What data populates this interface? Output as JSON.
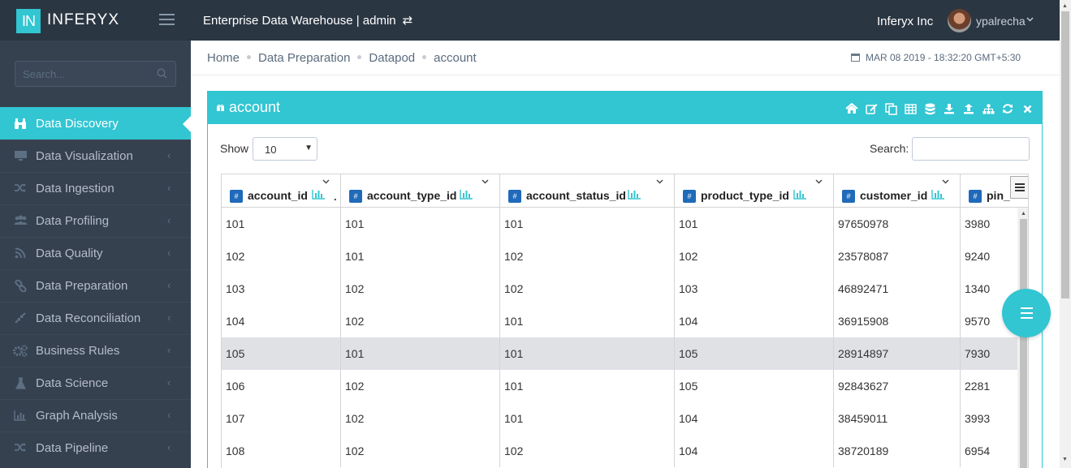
{
  "brand": {
    "logo_mark": "IN",
    "name": "INFERYX"
  },
  "header": {
    "app_title": "Enterprise Data Warehouse | admin",
    "switch_icon": "⇄",
    "org_name": "Inferyx Inc",
    "user_name": "ypalrecha"
  },
  "sidebar": {
    "search_placeholder": "Search...",
    "items": [
      {
        "label": "Data Discovery",
        "icon": "binoculars-icon",
        "active": true
      },
      {
        "label": "Data Visualization",
        "icon": "monitor-icon"
      },
      {
        "label": "Data Ingestion",
        "icon": "shuffle-icon"
      },
      {
        "label": "Data Profiling",
        "icon": "users-icon"
      },
      {
        "label": "Data Quality",
        "icon": "rss-icon"
      },
      {
        "label": "Data Preparation",
        "icon": "link-icon"
      },
      {
        "label": "Data Reconciliation",
        "icon": "compress-icon"
      },
      {
        "label": "Business Rules",
        "icon": "gears-icon"
      },
      {
        "label": "Data Science",
        "icon": "flask-icon"
      },
      {
        "label": "Graph Analysis",
        "icon": "bar-chart-icon"
      },
      {
        "label": "Data Pipeline",
        "icon": "shuffle-icon"
      }
    ]
  },
  "breadcrumb": [
    "Home",
    "Data Preparation",
    "Datapod",
    "account"
  ],
  "datetime": "MAR 08 2019 - 18:32:20 GMT+5:30",
  "portlet": {
    "title": "account",
    "tools": [
      "home-icon",
      "edit-icon",
      "copy-icon",
      "table-icon",
      "database-icon",
      "download-icon",
      "upload-icon",
      "sitemap-icon",
      "refresh-icon",
      "close-icon"
    ]
  },
  "controls": {
    "show_label": "Show",
    "page_size": "10",
    "search_label": "Search:"
  },
  "table": {
    "type_badge": "#",
    "columns": [
      "account_id",
      "account_type_id",
      "account_status_id",
      "product_type_id",
      "customer_id",
      "pin_"
    ],
    "rows": [
      [
        "101",
        "101",
        "101",
        "101",
        "97650978",
        "3980"
      ],
      [
        "102",
        "101",
        "102",
        "102",
        "23578087",
        "9240"
      ],
      [
        "103",
        "102",
        "102",
        "103",
        "46892471",
        "1340"
      ],
      [
        "104",
        "102",
        "101",
        "104",
        "36915908",
        "9570"
      ],
      [
        "105",
        "101",
        "101",
        "105",
        "28914897",
        "7930"
      ],
      [
        "106",
        "102",
        "101",
        "105",
        "92843627",
        "2281"
      ],
      [
        "107",
        "102",
        "101",
        "104",
        "38459011",
        "3993"
      ],
      [
        "108",
        "102",
        "102",
        "104",
        "38720189",
        "6954"
      ]
    ],
    "highlighted_row": 4
  },
  "colors": {
    "accent": "#32c5d2",
    "topbar": "#2b3643",
    "sidebar": "#364150",
    "type_badge": "#1f6ab9"
  }
}
